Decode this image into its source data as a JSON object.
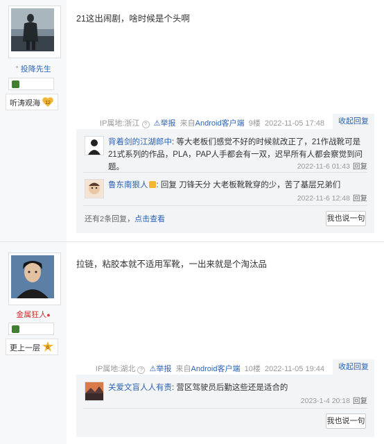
{
  "posts": [
    {
      "author": {
        "name": "投降先生",
        "name_prefix": "°",
        "badge_text": "听涛观海",
        "badge_level": "12"
      },
      "content": "21这出闹剧，啥时候是个头啊",
      "meta": {
        "ip": "IP属地:浙江",
        "report": "举报",
        "client_prefix": "来自",
        "client": "Android客户端",
        "floor": "9楼",
        "time": "2022-11-05 17:48"
      },
      "collapse_label": "收起回复",
      "replies": [
        {
          "name": "背着剑的江湖郎中",
          "text": ": 等大老板们感觉不好的时候就改正了，21作战靴可是21式系列的作品，PLA，PAP人手都会有一双，迟早所有人都会察觉到问题。",
          "time": "2022-11-6 01:43",
          "reply_label": "回复"
        },
        {
          "name": "鲁东南狠人",
          "text": ": 回复 刀锋天分 大老板靴靴穿的少，苦了基层兄弟们",
          "time": "2022-11-6 12:48",
          "reply_label": "回复"
        }
      ],
      "more_text": "还有2条回复，",
      "more_link": "点击查看",
      "say_label": "我也说一句"
    },
    {
      "author": {
        "name": "金属狂人",
        "badge_text": "更上一层",
        "badge_level": "6"
      },
      "content": "拉链，粘胶本就不适用军靴，一出来就是个淘汰品",
      "meta": {
        "ip": "IP属地:湖北",
        "report": "举报",
        "client_prefix": "来自",
        "client": "Android客户端",
        "floor": "10楼",
        "time": "2022-11-05 19:44"
      },
      "collapse_label": "收起回复",
      "replies": [
        {
          "name": "关爱文盲人人有责",
          "text": ": 营区驾驶员后勤这些还是适合的",
          "time": "2023-1-4 20:18",
          "reply_label": "回复"
        }
      ],
      "say_label": "我也说一句"
    }
  ],
  "colors": {
    "link": "#2d64b3",
    "badge_gold": "#f2b632",
    "sidebar_bg": "#f7f8fa",
    "reply_bg": "#f3f4f6"
  }
}
